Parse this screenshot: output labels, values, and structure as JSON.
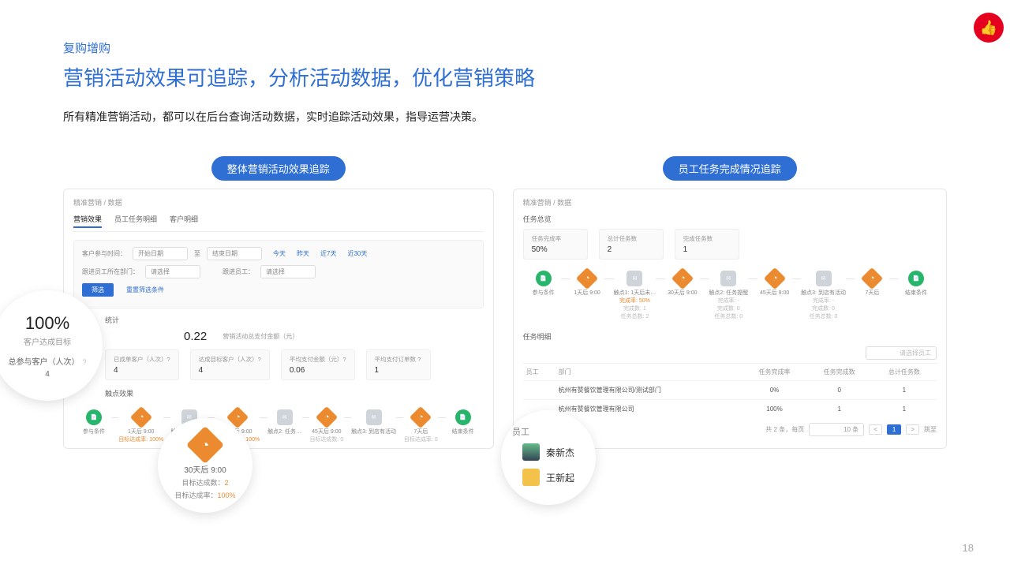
{
  "badge": "👍",
  "header": {
    "subtitle": "复购增购",
    "title": "营销活动效果可追踪，分析活动数据，优化营销策略",
    "desc": "所有精准营销活动，都可以在后台查询活动数据，实时追踪活动效果，指导运营决策。"
  },
  "pills": {
    "left": "整体营销活动效果追踪",
    "right": "员工任务完成情况追踪"
  },
  "left": {
    "crumb": "精准营销 / 数据",
    "tabs": [
      "营销效果",
      "员工任务明细",
      "客户明细"
    ],
    "filter": {
      "timeLabel": "客户参与时间：",
      "start": "开始日期",
      "to": "至",
      "end": "结束日期",
      "quick": [
        "今天",
        "昨天",
        "近7天",
        "近30天"
      ],
      "deptLabel": "跟进员工所在部门：",
      "deptPh": "请选择",
      "empLabel": "跟进员工：",
      "empPh": "请选择",
      "filterBtn": "筛选",
      "resetBtn": "重置筛选条件"
    },
    "section1": "统计",
    "statTop": {
      "big": "0.22",
      "label": "营销活动总支付金额（元）",
      "q": "?"
    },
    "cards": [
      {
        "lbl": "已成单客户（人次）?",
        "val": "4"
      },
      {
        "lbl": "达成目标客户（人次）?",
        "val": "4"
      },
      {
        "lbl": "平均支付金额（元）?",
        "val": "0.06"
      },
      {
        "lbl": "平均支付订单数 ?",
        "val": "1"
      }
    ],
    "section2": "触点效果",
    "flow": [
      {
        "icon": "doc",
        "t1": "参与条件",
        "t2": ""
      },
      {
        "icon": "org",
        "t1": "1天后 9:00",
        "t2": "目标达成率: 100%",
        "or": true
      },
      {
        "icon": "gry",
        "t1": "触点1: 1天未…",
        "t2": ""
      },
      {
        "icon": "org",
        "t1": "30天后 9:00",
        "t2": "目标达成率: 100%",
        "or": true
      },
      {
        "icon": "gry",
        "t1": "触点2: 任务…",
        "t2": ""
      },
      {
        "icon": "org",
        "t1": "45天后 9:00",
        "t2": "目标达成数: 0",
        "or": false
      },
      {
        "icon": "gry",
        "t1": "触点3: 到店有活动",
        "t2": ""
      },
      {
        "icon": "org",
        "t1": "7天后",
        "t2": "目标达成率: 0",
        "or": false
      },
      {
        "icon": "doc",
        "t1": "结束条件",
        "t2": ""
      }
    ]
  },
  "callout1": {
    "pct": "100%",
    "sub": "客户达成目标",
    "line": "总参与客户（人次）",
    "q": "?",
    "val": "4"
  },
  "callout2": {
    "t": "30天后 9:00",
    "r1a": "目标达成数：",
    "r1b": "2",
    "r2a": "目标达成率：",
    "r2b": "100%"
  },
  "right": {
    "crumb": "精准营销 / 数据",
    "sec1": "任务总览",
    "ov": [
      {
        "lbl": "任务完成率",
        "val": "50%"
      },
      {
        "lbl": "总计任务数",
        "val": "2"
      },
      {
        "lbl": "完成任务数",
        "val": "1"
      }
    ],
    "flow": [
      {
        "icon": "doc",
        "t1": "参与条件"
      },
      {
        "icon": "org",
        "t1": "1天后 9:00"
      },
      {
        "icon": "gry",
        "t1": "触点1: 1天后未…",
        "sub": [
          "完成率: 50%",
          "完成数: 1",
          "任务总数: 2"
        ]
      },
      {
        "icon": "org",
        "t1": "30天后 9:00"
      },
      {
        "icon": "gry",
        "t1": "触点2: 任务提醒",
        "sub": [
          "完成率: -",
          "完成数: 0",
          "任务总数: 0"
        ]
      },
      {
        "icon": "org",
        "t1": "45天后 9:00"
      },
      {
        "icon": "gry",
        "t1": "触点3: 到店有活动",
        "sub": [
          "完成率: -",
          "完成数: 0",
          "任务总数: 0"
        ]
      },
      {
        "icon": "org",
        "t1": "7天后"
      },
      {
        "icon": "doc",
        "t1": "结束条件"
      }
    ],
    "sec2": "任务明细",
    "searchPh": "请选择员工",
    "thead": [
      "员工",
      "部门",
      "任务完成率",
      "任务完成数",
      "总计任务数"
    ],
    "rows": [
      {
        "dept": "杭州有赞餐饮管理有限公司/测试部门",
        "rate": "0%",
        "done": "0",
        "total": "1"
      },
      {
        "dept": "杭州有赞餐饮管理有限公司",
        "rate": "100%",
        "done": "1",
        "total": "1"
      }
    ],
    "pager": {
      "info": "共 2 条，每页",
      "per": "10 条",
      "prev": "<",
      "cur": "1",
      "next": ">",
      "jump": "跳至"
    }
  },
  "callout3": {
    "hd": "员工",
    "n1": "秦新杰",
    "n2": "王新起"
  },
  "pageNum": "18"
}
